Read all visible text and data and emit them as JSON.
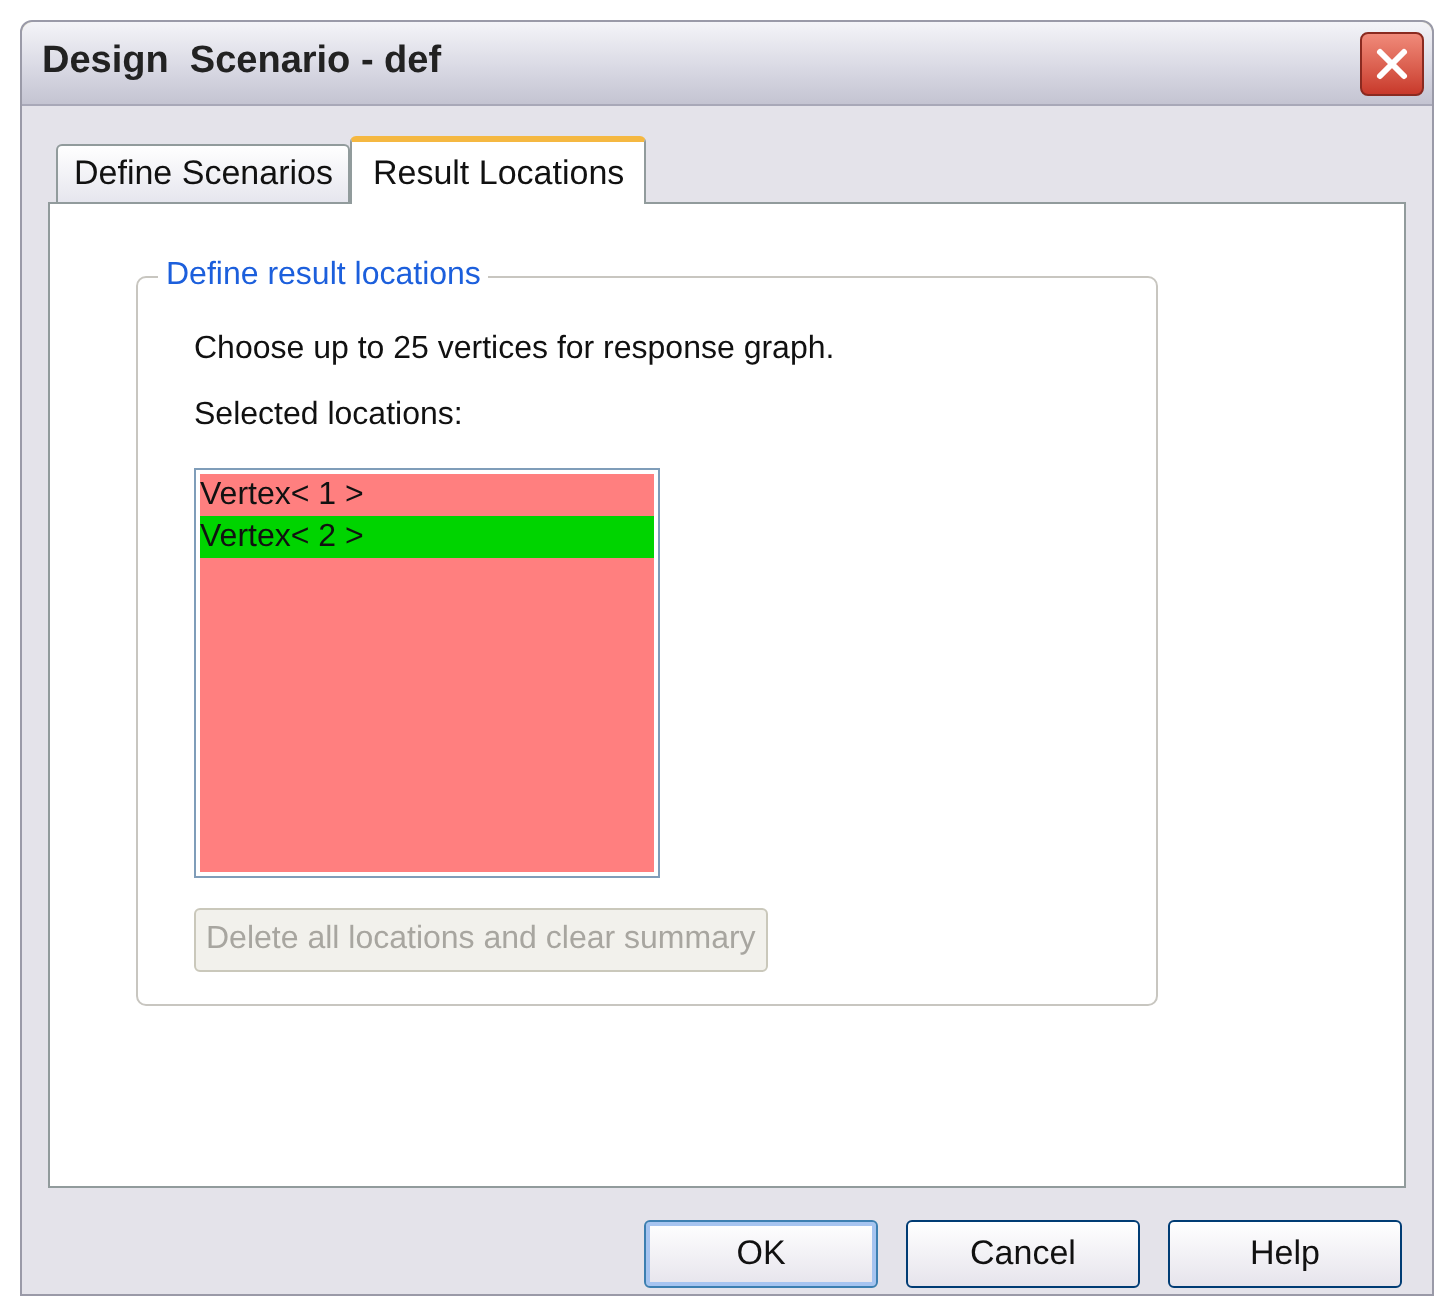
{
  "window": {
    "title": "Design  Scenario - def"
  },
  "tabs": [
    {
      "label": "Define Scenarios",
      "selected": false
    },
    {
      "label": "Result Locations",
      "selected": true
    }
  ],
  "group": {
    "title": "Define result locations",
    "instruction": "Choose up to 25 vertices for response graph.",
    "list_label": "Selected locations:",
    "items": [
      {
        "label": "Vertex< 1 >",
        "selected": false
      },
      {
        "label": "Vertex< 2 >",
        "selected": true
      }
    ],
    "delete_button": {
      "label": "Delete all locations and clear summary",
      "disabled": true
    }
  },
  "buttons": [
    {
      "label": "OK",
      "default": true
    },
    {
      "label": "Cancel",
      "default": false
    },
    {
      "label": "Help",
      "default": false
    }
  ]
}
